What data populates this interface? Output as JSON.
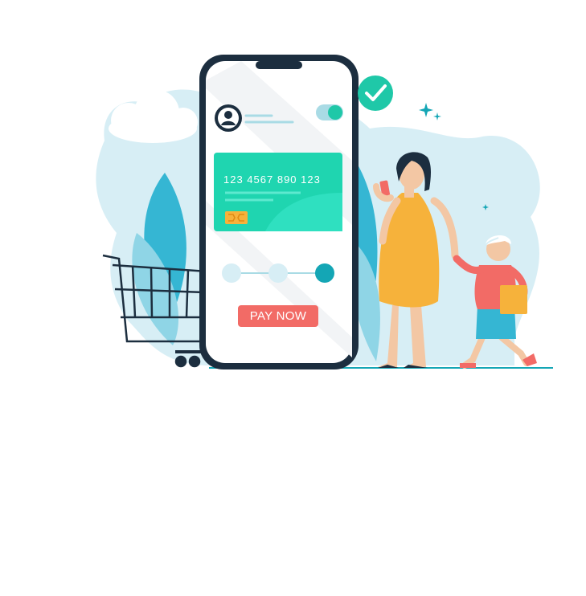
{
  "phone_screen": {
    "card": {
      "number": "123 4567 890 123"
    },
    "pay_button_label": "PAY NOW",
    "toggle_on": true,
    "steps": {
      "count": 3,
      "active": 3
    }
  },
  "colors": {
    "card": "#1fd5b0",
    "phone_frame": "#1c2e3f",
    "accent_teal": "#14a6b5",
    "button": "#f26b66",
    "background_blob": "#d7eef5",
    "leaf": "#35b6d3",
    "dress": "#f6b23b",
    "check_circle": "#1fc8a8"
  },
  "icons": [
    "avatar-icon",
    "check-icon",
    "sparkle-icon",
    "chip-icon",
    "shopping-cart-icon"
  ]
}
